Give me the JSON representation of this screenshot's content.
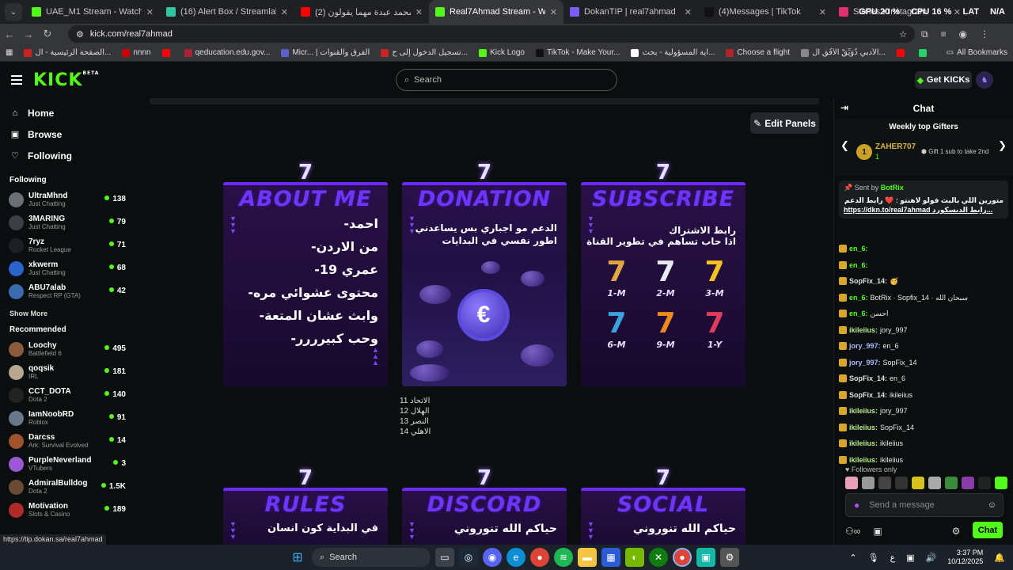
{
  "browser": {
    "tabs": [
      {
        "title": "UAE_M1 Stream - Watch Live o",
        "color": "#53fc18",
        "active": false
      },
      {
        "title": "(16) Alert Box / Streamlabs",
        "color": "#31c3a2",
        "active": false
      },
      {
        "title": "محمد عبدة مهما يقولون (2)",
        "prefix": "be -",
        "color": "#ff0000",
        "active": false
      },
      {
        "title": "Real7Ahmad Stream - Watch Li",
        "color": "#53fc18",
        "active": true
      },
      {
        "title": "DokanTIP | real7ahmad",
        "color": "#7a5cff",
        "active": false
      },
      {
        "title": "(4)Messages | TikTok",
        "color": "#111111",
        "active": false
      },
      {
        "title": "Stories • Instagram",
        "color": "#e1306c",
        "active": false
      }
    ],
    "system": {
      "gpu_label": "GPU",
      "gpu_value": "20 %",
      "cpu_label": "CPU",
      "cpu_value": "16 %",
      "lang1": "LAT",
      "lang2": "N/A"
    },
    "url": "kick.com/real7ahmad",
    "bookmarks": [
      {
        "label": "الصفحة الرئيسية - ال...",
        "color": "#cc2222"
      },
      {
        "label": "nnnn",
        "color": "#cc0000"
      },
      {
        "label": "",
        "color": "#ff0000"
      },
      {
        "label": "qeducation.edu.gov...",
        "color": "#aa2233"
      },
      {
        "label": "Micr... | الفرق والقنوات",
        "color": "#5b5fc7"
      },
      {
        "label": "تسجيل الدخول إلى ح...",
        "color": "#cc2222"
      },
      {
        "label": "Kick Logo",
        "color": "#53fc18"
      },
      {
        "label": "TikTok - Make Your...",
        "color": "#111111"
      },
      {
        "label": "اية المسؤولية - بحث...",
        "color": "#ffffff"
      },
      {
        "label": "Choose a flight",
        "color": "#b0232a"
      },
      {
        "label": "الأدبي ذُوَيِّقْ الأُفُقِ ال...",
        "color": "#888888"
      },
      {
        "label": "",
        "color": "#ff0000"
      },
      {
        "label": "WhatsApp Web",
        "color": "#25d366"
      },
      {
        "label": "",
        "color": "#ff0000"
      }
    ],
    "all_bookmarks": "All Bookmarks",
    "status_url": "https://tip.dokan.sa/real7ahmad"
  },
  "kick": {
    "logo": "KICK",
    "logo_sup": "BETA",
    "search_placeholder": "Search",
    "get_kicks": "Get KICKs",
    "nav": [
      {
        "label": "Home",
        "icon": "home-icon"
      },
      {
        "label": "Browse",
        "icon": "browse-icon"
      },
      {
        "label": "Following",
        "icon": "heart-icon"
      }
    ],
    "following_title": "Following",
    "following": [
      {
        "name": "UltraMhnd",
        "category": "Just Chatting",
        "viewers": "138",
        "color": "#6b6f76"
      },
      {
        "name": "3MARING",
        "category": "Just Chatting",
        "viewers": "79",
        "color": "#3b3f46"
      },
      {
        "name": "7ryz",
        "category": "Rocket League",
        "viewers": "71",
        "color": "#1d2024"
      },
      {
        "name": "xkwerm",
        "category": "Just Chatting",
        "viewers": "68",
        "color": "#2a63c9"
      },
      {
        "name": "ABU7alab",
        "category": "Respect RP (GTA)",
        "viewers": "42",
        "color": "#3c6ab0"
      }
    ],
    "show_more": "Show More",
    "recommended_title": "Recommended",
    "recommended": [
      {
        "name": "Loochy",
        "category": "Battlefield 6",
        "viewers": "495",
        "color": "#8a5a3c"
      },
      {
        "name": "qoqsik",
        "category": "IRL",
        "viewers": "181",
        "color": "#b9a68f"
      },
      {
        "name": "CCT_DOTA",
        "category": "Dota 2",
        "viewers": "140",
        "color": "#222222"
      },
      {
        "name": "IamNoobRD",
        "category": "Roblox",
        "viewers": "91",
        "color": "#667788"
      },
      {
        "name": "Darcss",
        "category": "Ark: Survival Evolved",
        "viewers": "14",
        "color": "#a0522d"
      },
      {
        "name": "PurpleNeverland",
        "category": "VTubers",
        "viewers": "3",
        "color": "#9b59d6"
      },
      {
        "name": "AdmiralBulldog",
        "category": "Dota 2",
        "viewers": "1.5K",
        "color": "#6b4b34"
      },
      {
        "name": "Motivation",
        "category": "Slots & Casino",
        "viewers": "189",
        "color": "#b02a2a"
      }
    ],
    "edit_panels": "Edit Panels"
  },
  "panels": {
    "about": {
      "title": "ABOUT ME",
      "lines": [
        "-احمد",
        "-من الاردن",
        "-عمري 19",
        "-محتوى عشوائي مره",
        "-وابث عشان المتعة",
        "-وحب كبيرررر"
      ]
    },
    "donation": {
      "title": "DONATION",
      "lines": [
        "الدعم مو اجباري بس يساعدني",
        "اطور نفسي في البدايات"
      ],
      "coin_symbol": "€"
    },
    "subscribe": {
      "title": "SUBSCRIBE",
      "lines": [
        "رابط الاشتراك",
        "اذا حاب تساهم في تطوير القناة"
      ],
      "tiers": [
        {
          "label": "1-M",
          "color": "#e0a640"
        },
        {
          "label": "2-M",
          "color": "#e9e9f2"
        },
        {
          "label": "3-M",
          "color": "#f2c21e"
        },
        {
          "label": "6-M",
          "color": "#3aa2e0"
        },
        {
          "label": "9-M",
          "color": "#f08a1c"
        },
        {
          "label": "1-Y",
          "color": "#e23a5a"
        }
      ]
    },
    "scores": [
      "الاتحاد 11",
      "الهلال 12",
      "النصر 13",
      "الاهلي 14"
    ],
    "rules": {
      "title": "RULES",
      "line": "في البداية كون انسان"
    },
    "discord": {
      "title": "DISCORD",
      "line": "حياكم الله تنوروني"
    },
    "social": {
      "title": "SOCIAL",
      "line": "حياكم الله تنوروني"
    }
  },
  "chat": {
    "title": "Chat",
    "weekly_title": "Weekly top Gifters",
    "top_gifter": {
      "rank": "1",
      "name": "ZAHER707",
      "count": "1"
    },
    "gift_hint": "Gift 1 sub to take 2nd",
    "pinned": {
      "sent_by": "Sent by",
      "user": "BotRix",
      "text": "متورين اللي بالبث فولو لاهنتو : ❤️ رابط الدعم",
      "link": "https://dkn.to/real7ahmad",
      "tail": "رابط الديسكورد..."
    },
    "messages": [
      {
        "user": "en_6:",
        "color": "#53fc18",
        "text": ""
      },
      {
        "user": "en_6:",
        "color": "#53fc18",
        "text": ""
      },
      {
        "user": "SopFix_14:",
        "color": "#e0e0e0",
        "text": "🥳"
      },
      {
        "user": "en_6:",
        "color": "#53fc18",
        "text": "BotRix · Sopfix_14 · سبحان الله"
      },
      {
        "user": "en_6:",
        "color": "#53fc18",
        "text": "احسن"
      },
      {
        "user": "ikileiius:",
        "color": "#b7f08a",
        "text": "jory_997"
      },
      {
        "user": "jory_997:",
        "color": "#a8b8ff",
        "text": "en_6"
      },
      {
        "user": "jory_997:",
        "color": "#a8b8ff",
        "text": "SopFix_14"
      },
      {
        "user": "SopFix_14:",
        "color": "#e0e0e0",
        "text": "en_6"
      },
      {
        "user": "SopFix_14:",
        "color": "#e0e0e0",
        "text": "ikileiius"
      },
      {
        "user": "ikileiius:",
        "color": "#b7f08a",
        "text": "jory_997"
      },
      {
        "user": "ikileiius:",
        "color": "#b7f08a",
        "text": "SopFix_14"
      },
      {
        "user": "ikileiius:",
        "color": "#b7f08a",
        "text": "ikileiius"
      },
      {
        "user": "ikileiius:",
        "color": "#b7f08a",
        "text": "ikileiius"
      }
    ],
    "followers_only": "Followers only",
    "input_placeholder": "Send a message",
    "chat_button": "Chat"
  },
  "taskbar": {
    "search": "Search",
    "time": "3:37 PM",
    "date": "10/12/2025"
  }
}
